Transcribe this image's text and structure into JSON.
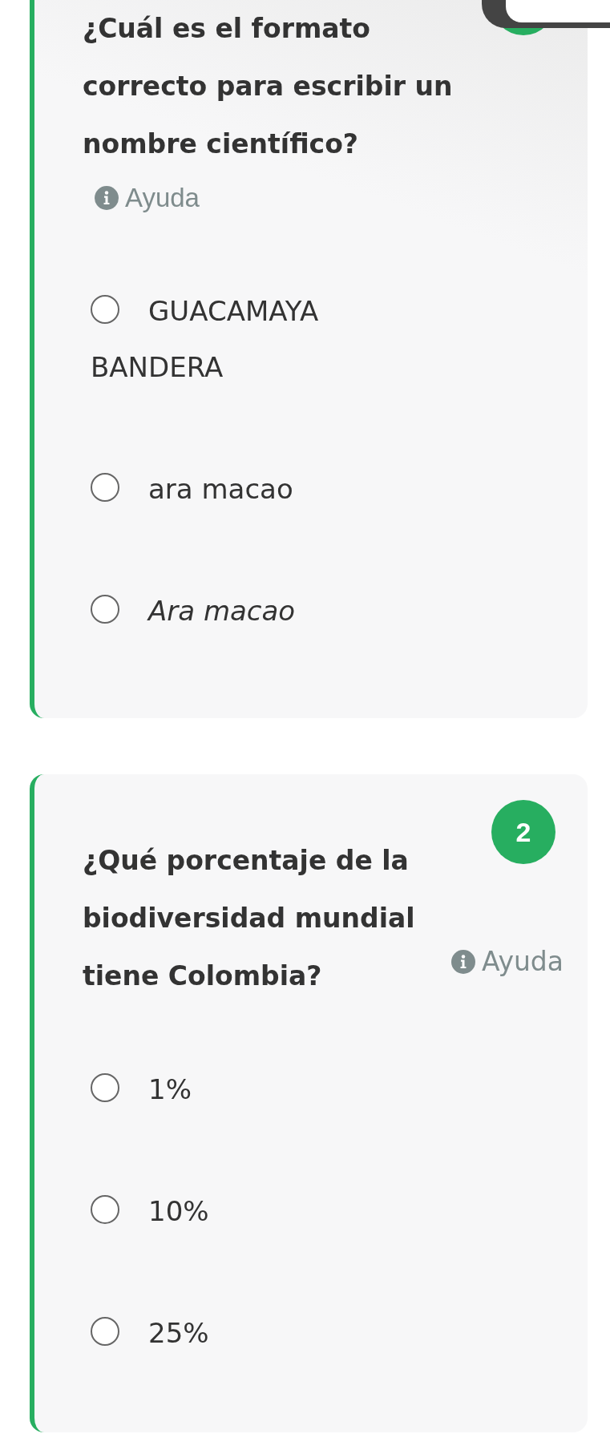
{
  "questions": [
    {
      "title": "¿Cuál es el formato correcto para escribir un nombre científico?",
      "help": "Ayuda",
      "help_inline": false,
      "options": [
        {
          "label": "GUACAMAYA BANDERA",
          "selected": false,
          "italic": false
        },
        {
          "label": "ara macao",
          "selected": false,
          "italic": false
        },
        {
          "label": "Ara macao",
          "selected": false,
          "italic": true
        }
      ]
    },
    {
      "number": "2",
      "title": "¿Qué porcentaje de la biodiversidad mundial tiene Colombia?",
      "help": "Ayuda",
      "help_inline": true,
      "options": [
        {
          "label": "1%",
          "selected": false,
          "italic": false
        },
        {
          "label": "10%",
          "selected": false,
          "italic": false
        },
        {
          "label": "25%",
          "selected": false,
          "italic": false
        }
      ]
    }
  ]
}
